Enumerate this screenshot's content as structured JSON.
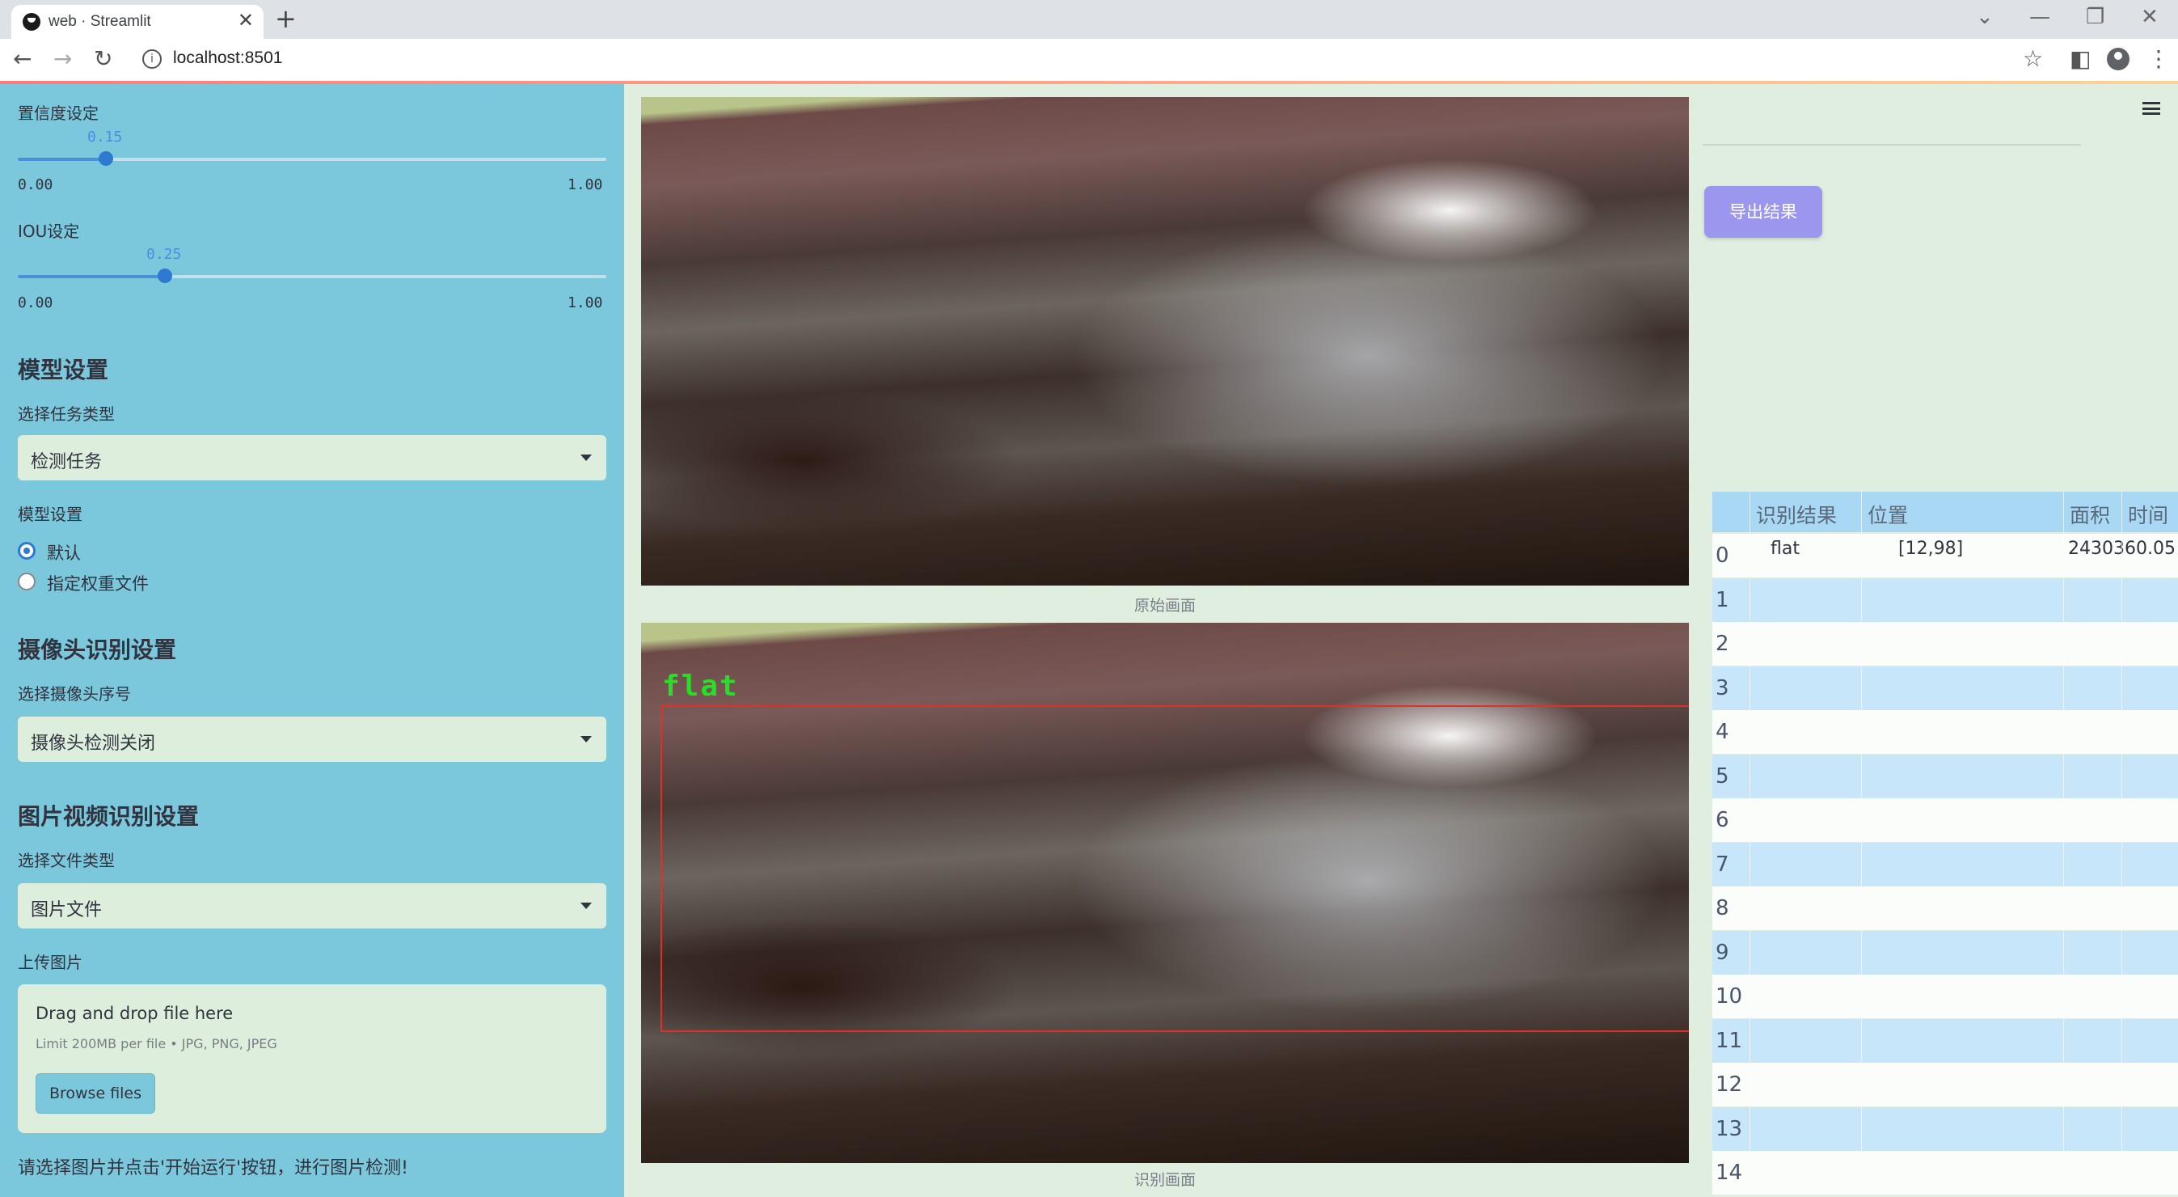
{
  "browser": {
    "tab_title": "web · Streamlit",
    "tab_close": "✕",
    "new_tab": "+",
    "url": "localhost:8501",
    "back": "←",
    "forward": "→",
    "reload": "↻",
    "bookmark": "☆",
    "sidepanel": "◧",
    "more": "⋮",
    "minimize": "—",
    "restore": "❐",
    "close": "✕",
    "dropdown": "⌄"
  },
  "sidebar": {
    "confidence": {
      "label": "置信度设定",
      "value": "0.15",
      "value_fraction": 0.15,
      "min": "0.00",
      "max": "1.00"
    },
    "iou": {
      "label": "IOU设定",
      "value": "0.25",
      "value_fraction": 0.25,
      "min": "0.00",
      "max": "1.00"
    },
    "model_section": {
      "heading": "模型设置",
      "task_label": "选择任务类型",
      "task_value": "检测任务",
      "model_label": "模型设置",
      "options": [
        "默认",
        "指定权重文件"
      ],
      "selected_option": "默认"
    },
    "camera_section": {
      "heading": "摄像头识别设置",
      "label": "选择摄像头序号",
      "value": "摄像头检测关闭"
    },
    "media_section": {
      "heading": "图片视频识别设置",
      "file_type_label": "选择文件类型",
      "file_type_value": "图片文件",
      "upload_label": "上传图片",
      "drop_text": "Drag and drop file here",
      "limit_text": "Limit 200MB per file • JPG, PNG, JPEG",
      "browse_label": "Browse files"
    },
    "hint": "请选择图片并点击'开始运行'按钮，进行图片检测!"
  },
  "main": {
    "original_caption": "原始画面",
    "detected_caption": "识别画面",
    "detection_label": "flat"
  },
  "right": {
    "export_label": "导出结果",
    "table": {
      "columns": [
        "识别结果",
        "位置",
        "面积",
        "时间"
      ],
      "rows": [
        {
          "index": "0",
          "result": "flat",
          "position": "[12,98]",
          "area": "2430360.05",
          "time": ""
        },
        {
          "index": "1"
        },
        {
          "index": "2"
        },
        {
          "index": "3"
        },
        {
          "index": "4"
        },
        {
          "index": "5"
        },
        {
          "index": "6"
        },
        {
          "index": "7"
        },
        {
          "index": "8"
        },
        {
          "index": "9"
        },
        {
          "index": "10"
        },
        {
          "index": "11"
        },
        {
          "index": "12"
        },
        {
          "index": "13"
        },
        {
          "index": "14"
        }
      ]
    }
  },
  "colors": {
    "sidebar_bg": "#7bc8dc",
    "page_bg": "#dfeedf",
    "accent_blue": "#2e7ad1",
    "export_button": "#9b96ee",
    "table_header": "#a8d8f4",
    "row_alt": "#c8e6fa",
    "detection_box": "#e0302a",
    "detection_label": "#25e025"
  }
}
